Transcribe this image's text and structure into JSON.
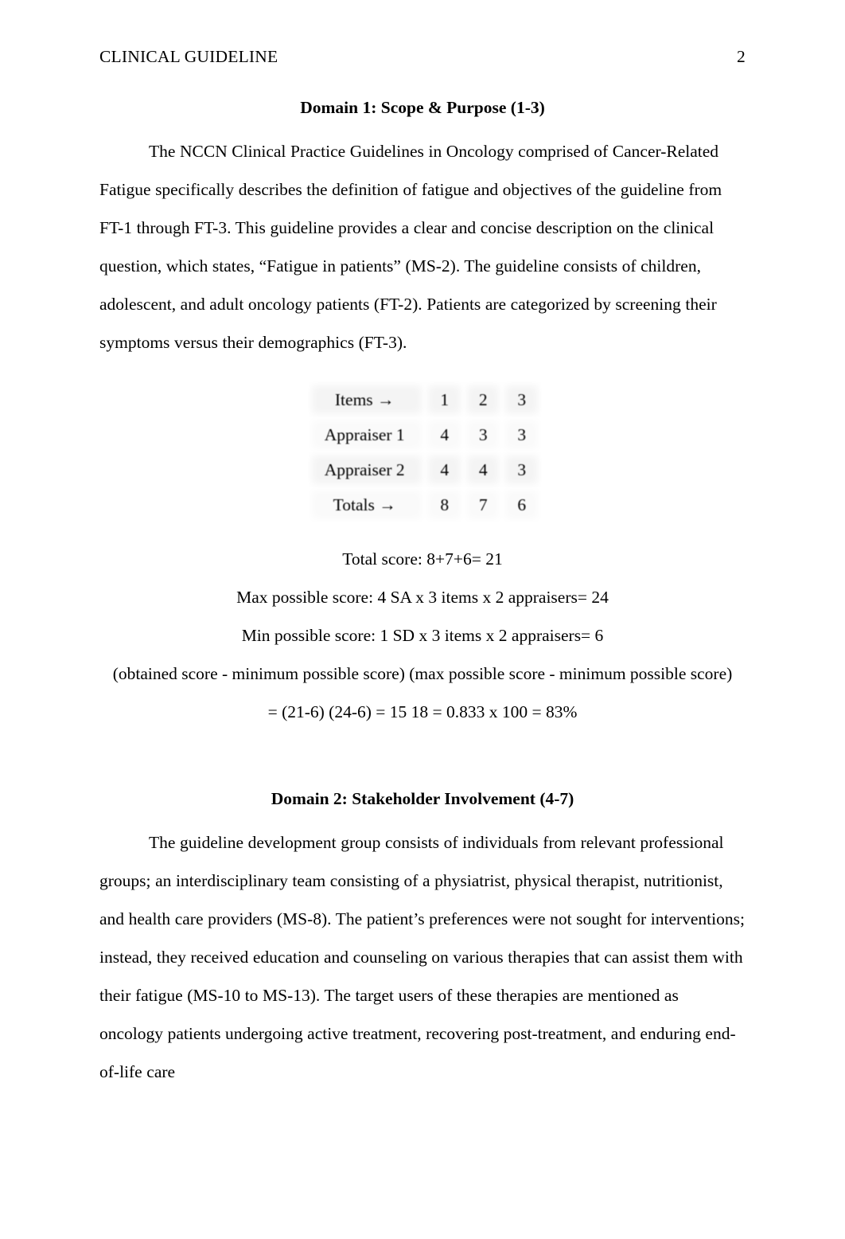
{
  "header": {
    "title": "CLINICAL GUIDELINE",
    "page_number": "2"
  },
  "domain1": {
    "heading": "Domain 1: Scope & Purpose (1-3)",
    "paragraph": "The NCCN Clinical Practice Guidelines in Oncology comprised of Cancer-Related Fatigue specifically describes the definition of fatigue and objectives of the guideline from FT-1 through FT-3. This guideline provides a clear and concise description on the clinical question, which states, “Fatigue in patients” (MS-2). The guideline consists of children, adolescent, and adult oncology patients (FT-2). Patients are categorized by screening their symptoms versus their demographics (FT-3)."
  },
  "score_table": {
    "rows": [
      {
        "label": "Items →",
        "values": [
          "1",
          "2",
          "3"
        ]
      },
      {
        "label": "Appraiser 1",
        "values": [
          "4",
          "3",
          "3"
        ]
      },
      {
        "label": "Appraiser 2",
        "values": [
          "4",
          "4",
          "3"
        ]
      },
      {
        "label": "Totals →",
        "values": [
          "8",
          "7",
          "6"
        ]
      }
    ]
  },
  "calculations": {
    "total_score": "Total score: 8+7+6= 21",
    "max_possible": "Max possible score: 4 SA x 3 items x 2 appraisers= 24",
    "min_possible": "Min possible score: 1 SD x 3 items x 2 appraisers= 6",
    "formula": "(obtained score - minimum possible score) (max possible score - minimum possible score)",
    "result": "= (21-6) (24-6) = 15 18 = 0.833 x 100 = 83%"
  },
  "domain2": {
    "heading": "Domain 2: Stakeholder Involvement (4-7)",
    "paragraph": "The guideline development group consists of individuals from relevant professional groups; an interdisciplinary team consisting of a physiatrist, physical therapist, nutritionist, and health care providers (MS-8). The patient’s preferences were not sought for interventions; instead, they received education and counseling on various therapies that can assist them with their fatigue (MS-10 to MS-13). The target users of these therapies are mentioned as oncology patients undergoing active treatment, recovering post-treatment, and enduring end-of-life care"
  }
}
